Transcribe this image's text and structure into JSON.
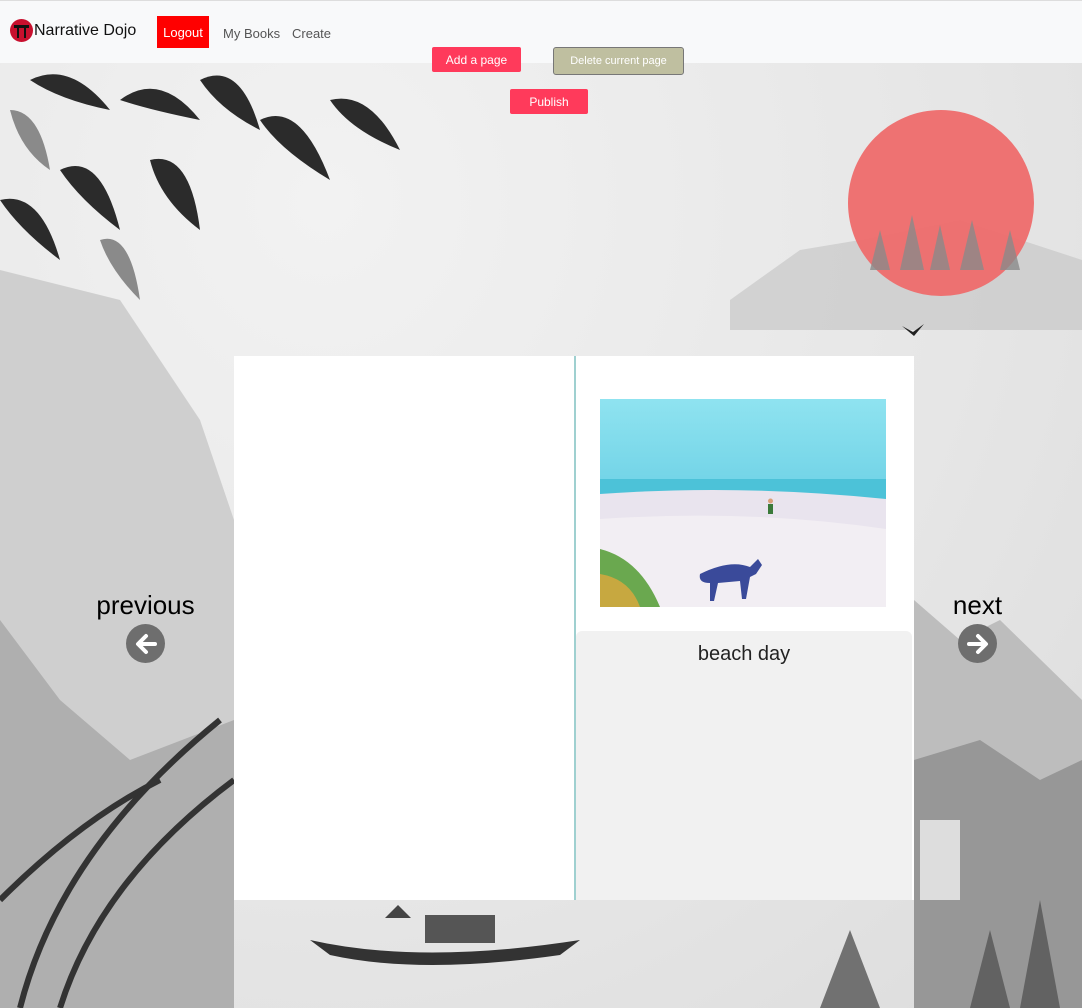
{
  "navbar": {
    "brand": "Narrative Dojo",
    "logout": "Logout",
    "links": [
      "My Books",
      "Create"
    ]
  },
  "toolbar": {
    "add_page": "Add a page",
    "delete_page": "Delete current page",
    "publish": "Publish"
  },
  "book": {
    "right_page": {
      "image_alt": "watercolor beach scene with dog",
      "caption": "beach day"
    }
  },
  "navigation": {
    "previous": "previous",
    "next": "next"
  },
  "colors": {
    "accent": "#ff3a5b",
    "logout": "#ff0000",
    "sun": "#ee6b6b"
  }
}
